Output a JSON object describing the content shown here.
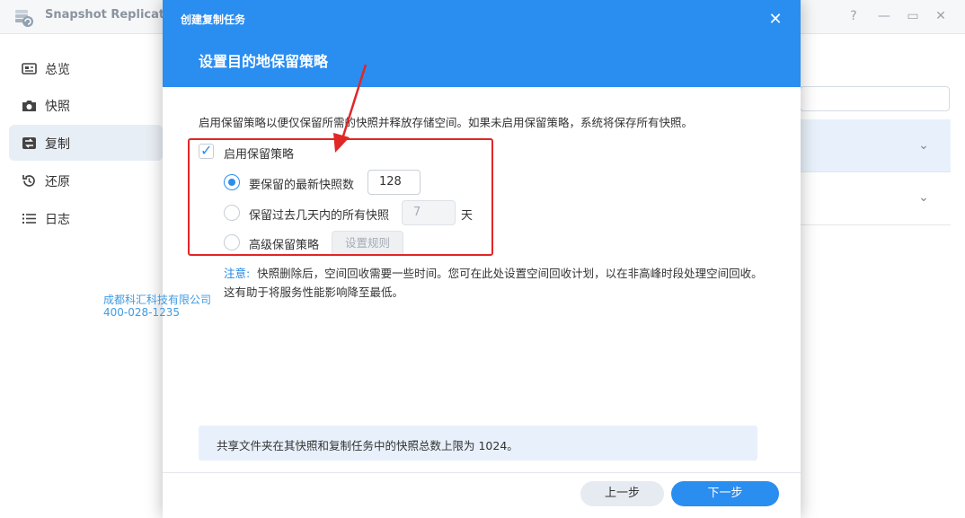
{
  "app": {
    "title": "Snapshot Replication",
    "window_controls": [
      "?",
      "—",
      "▭",
      "✕"
    ]
  },
  "sidebar": {
    "items": [
      {
        "label": "总览",
        "icon": "overview-icon"
      },
      {
        "label": "快照",
        "icon": "camera-icon"
      },
      {
        "label": "复制",
        "icon": "replication-icon",
        "active": true
      },
      {
        "label": "还原",
        "icon": "restore-icon"
      },
      {
        "label": "日志",
        "icon": "log-icon"
      }
    ]
  },
  "watermark": {
    "company": "成都科汇科技有限公司",
    "phone": "400-028-1235"
  },
  "dialog": {
    "small_title": "创建复制任务",
    "title": "设置目的地保留策略",
    "close_label": "✕",
    "description": "启用保留策略以便仅保留所需的快照并释放存储空间。如果未启用保留策略，系统将保存所有快照。",
    "enable_policy": {
      "label": "启用保留策略",
      "checked": true
    },
    "options": [
      {
        "label": "要保留的最新快照数",
        "checked": true,
        "value": "128"
      },
      {
        "label": "保留过去几天内的所有快照",
        "checked": false,
        "value": "7",
        "unit": "天",
        "disabled": true
      },
      {
        "label": "高级保留策略",
        "checked": false,
        "button_label": "设置规则",
        "disabled": true
      }
    ],
    "note": {
      "label": "注意:",
      "text": "快照删除后，空间回收需要一些时间。您可在此处设置空间回收计划，以在非高峰时段处理空间回收。这有助于将服务性能影响降至最低。"
    },
    "info": "共享文件夹在其快照和复制任务中的快照总数上限为 1024。",
    "buttons": {
      "prev": "上一步",
      "next": "下一步"
    }
  },
  "colors": {
    "accent": "#2a8df0",
    "annotation": "#e12626",
    "info_bg": "#e8f1fb"
  }
}
